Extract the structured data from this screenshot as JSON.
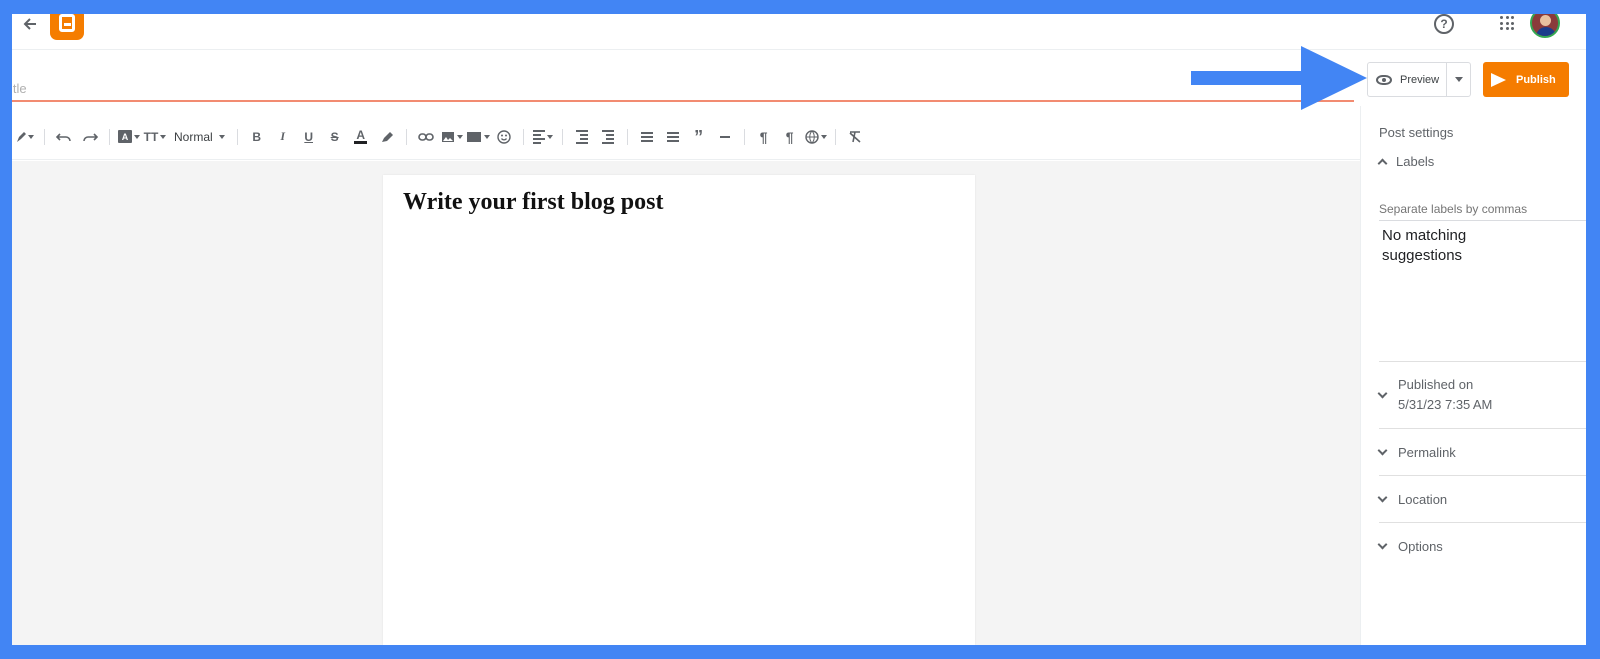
{
  "topbar": {
    "back_icon": "arrow-back-icon",
    "logo_icon": "blogger-logo-icon",
    "help_glyph": "?",
    "help_icon": "help-circle-icon",
    "apps_icon": "apps-grid-icon",
    "avatar_icon": "user-avatar"
  },
  "title": {
    "placeholder": "Title",
    "visible_text": "itle"
  },
  "actions": {
    "preview_label": "Preview",
    "publish_label": "Publish",
    "brand_color": "#f57c00"
  },
  "callout": {
    "icon": "pointer-arrow-icon",
    "color": "#4285f4"
  },
  "toolbar": {
    "format_label": "Normal",
    "bold_glyph": "B",
    "italic_glyph": "I",
    "underline_glyph": "U",
    "strike_glyph": "S",
    "text_color_glyph": "A",
    "font_glyph": "A",
    "size_glyph": "TT",
    "quote_glyph": "”",
    "ltr_glyph": "¶",
    "rtl_glyph": "¶"
  },
  "editor": {
    "heading": "Write your first blog post"
  },
  "sidebar": {
    "title": "Post settings",
    "labels_section": "Labels",
    "labels_placeholder": "Separate labels by commas",
    "no_match": "No matching suggestions",
    "published_label": "Published on",
    "published_date": "5/31/23 7:35 AM",
    "permalink": "Permalink",
    "location": "Location",
    "options": "Options"
  }
}
